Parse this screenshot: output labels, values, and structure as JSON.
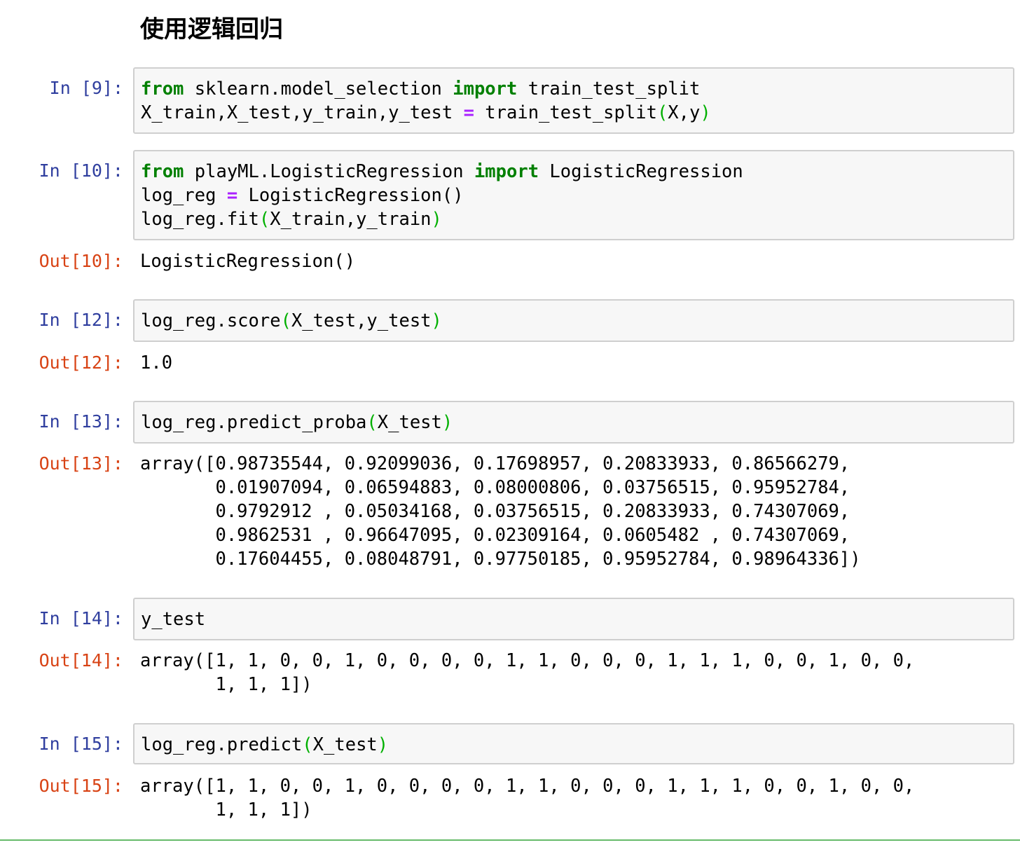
{
  "heading": "使用逻辑回归",
  "cells": [
    {
      "in_prompt": "In [9]:",
      "code": [
        [
          [
            "kw",
            "from"
          ],
          [
            "n",
            " sklearn.model_selection "
          ],
          [
            "kw",
            "import"
          ],
          [
            "n",
            " train_test_split"
          ]
        ],
        [
          [
            "n",
            "X_train,X_test,y_train,y_test "
          ],
          [
            "op",
            "="
          ],
          [
            "n",
            " train_test_split"
          ],
          [
            "pn",
            "("
          ],
          [
            "n",
            "X,y"
          ],
          [
            "pn",
            ")"
          ]
        ]
      ]
    },
    {
      "in_prompt": "In [10]:",
      "code": [
        [
          [
            "kw",
            "from"
          ],
          [
            "n",
            " playML.LogisticRegression "
          ],
          [
            "kw",
            "import"
          ],
          [
            "n",
            " LogisticRegression"
          ]
        ],
        [
          [
            "n",
            "log_reg "
          ],
          [
            "op",
            "="
          ],
          [
            "n",
            " LogisticRegression()"
          ]
        ],
        [
          [
            "n",
            "log_reg.fit"
          ],
          [
            "pn",
            "("
          ],
          [
            "n",
            "X_train,y_train"
          ],
          [
            "pn",
            ")"
          ]
        ]
      ],
      "out_prompt": "Out[10]:",
      "output": "LogisticRegression()"
    },
    {
      "in_prompt": "In [12]:",
      "code": [
        [
          [
            "n",
            "log_reg.score"
          ],
          [
            "pn",
            "("
          ],
          [
            "n",
            "X_test,y_test"
          ],
          [
            "pn",
            ")"
          ]
        ]
      ],
      "out_prompt": "Out[12]:",
      "output": "1.0"
    },
    {
      "in_prompt": "In [13]:",
      "code": [
        [
          [
            "n",
            "log_reg.predict_proba"
          ],
          [
            "pn",
            "("
          ],
          [
            "n",
            "X_test"
          ],
          [
            "pn",
            ")"
          ]
        ]
      ],
      "out_prompt": "Out[13]:",
      "output": "array([0.98735544, 0.92099036, 0.17698957, 0.20833933, 0.86566279,\n       0.01907094, 0.06594883, 0.08000806, 0.03756515, 0.95952784,\n       0.9792912 , 0.05034168, 0.03756515, 0.20833933, 0.74307069,\n       0.9862531 , 0.96647095, 0.02309164, 0.0605482 , 0.74307069,\n       0.17604455, 0.08048791, 0.97750185, 0.95952784, 0.98964336])"
    },
    {
      "in_prompt": "In [14]:",
      "code": [
        [
          [
            "n",
            "y_test"
          ]
        ]
      ],
      "out_prompt": "Out[14]:",
      "output": "array([1, 1, 0, 0, 1, 0, 0, 0, 0, 1, 1, 0, 0, 0, 1, 1, 1, 0, 0, 1, 0, 0,\n       1, 1, 1])"
    },
    {
      "in_prompt": "In [15]:",
      "code": [
        [
          [
            "n",
            "log_reg.predict"
          ],
          [
            "pn",
            "("
          ],
          [
            "n",
            "X_test"
          ],
          [
            "pn",
            ")"
          ]
        ]
      ],
      "out_prompt": "Out[15]:",
      "output": "array([1, 1, 0, 0, 1, 0, 0, 0, 0, 1, 1, 0, 0, 0, 1, 1, 1, 0, 0, 1, 0, 0,\n       1, 1, 1])"
    }
  ]
}
